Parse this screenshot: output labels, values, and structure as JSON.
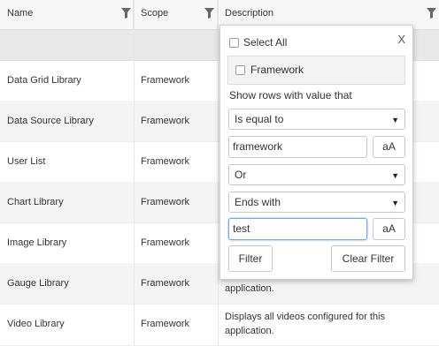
{
  "columns": [
    {
      "label": "Name",
      "icon": "filter-funnel-icon"
    },
    {
      "label": "Scope",
      "icon": "filter-funnel-icon"
    },
    {
      "label": "Description",
      "icon": "filter-funnel-icon"
    }
  ],
  "rows": [
    {
      "name": "Data Grid Library",
      "scope": "Framework",
      "desc": ""
    },
    {
      "name": "Data Source Library",
      "scope": "Framework",
      "desc": ""
    },
    {
      "name": "User List",
      "scope": "Framework",
      "desc": ""
    },
    {
      "name": "Chart Library",
      "scope": "Framework",
      "desc": ""
    },
    {
      "name": "Image Library",
      "scope": "Framework",
      "desc": ""
    },
    {
      "name": "Gauge Library",
      "scope": "Framework",
      "desc": "application."
    },
    {
      "name": "Video Library",
      "scope": "Framework",
      "desc": "Displays all videos configured for this application."
    }
  ],
  "filter_popup": {
    "select_all_label": "Select All",
    "select_all_checked": false,
    "close_label": "X",
    "values": [
      {
        "label": "Framework",
        "checked": false
      }
    ],
    "show_rows_label": "Show rows with value that",
    "operator1": "Is equal to",
    "value1": "framework",
    "match_case_label": "aA",
    "logic": "Or",
    "operator2": "Ends with",
    "value2": "test",
    "filter_button": "Filter",
    "clear_button": "Clear Filter"
  },
  "colors": {
    "header_bg": "#f7f7f7",
    "alt_row": "#f4f4f4",
    "focus_border": "#7aa7d9"
  }
}
